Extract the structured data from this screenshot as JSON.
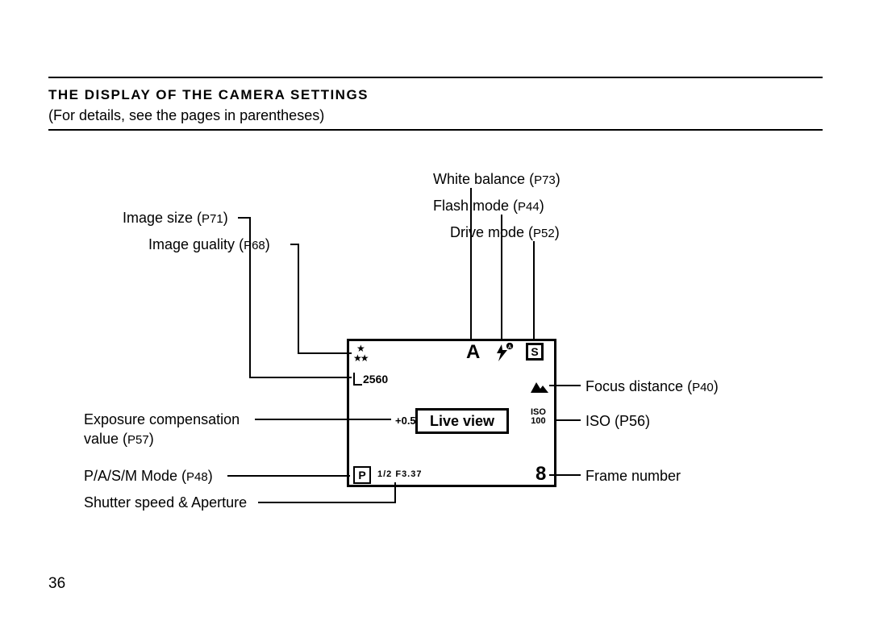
{
  "header": {
    "title": "THE DISPLAY OF THE CAMERA SETTINGS",
    "subtitle": "(For details, see the pages in parentheses)"
  },
  "page_number": "36",
  "display": {
    "white_balance": "A",
    "drive_letter": "S",
    "image_size_value": "2560",
    "live_view": "Live view",
    "ev_comp": "+0.5",
    "iso_label": "ISO",
    "iso_value": "100",
    "mode_letter": "P",
    "shutter_aperture": "1/2 F3.37",
    "frame_number": "8"
  },
  "labels": {
    "white_balance": {
      "text": "White balance",
      "page": "P73"
    },
    "flash_mode": {
      "text": "Flash mode",
      "page": "P44"
    },
    "drive_mode": {
      "text": "Drive mode",
      "page": "P52"
    },
    "image_size": {
      "text": "Image size",
      "page": "P71"
    },
    "image_quality": {
      "text": "Image guality",
      "page": "P68"
    },
    "focus_distance": {
      "text": "Focus distance",
      "page": "P40"
    },
    "iso": {
      "text": "ISO (P56)"
    },
    "ev_comp": {
      "text1": "Exposure compensation",
      "text2": "value",
      "page": "P57"
    },
    "pasm": {
      "text": "P/A/S/M Mode",
      "page": "P48"
    },
    "shutter": {
      "text": "Shutter speed & Aperture"
    },
    "frame_number": {
      "text": "Frame number"
    }
  }
}
